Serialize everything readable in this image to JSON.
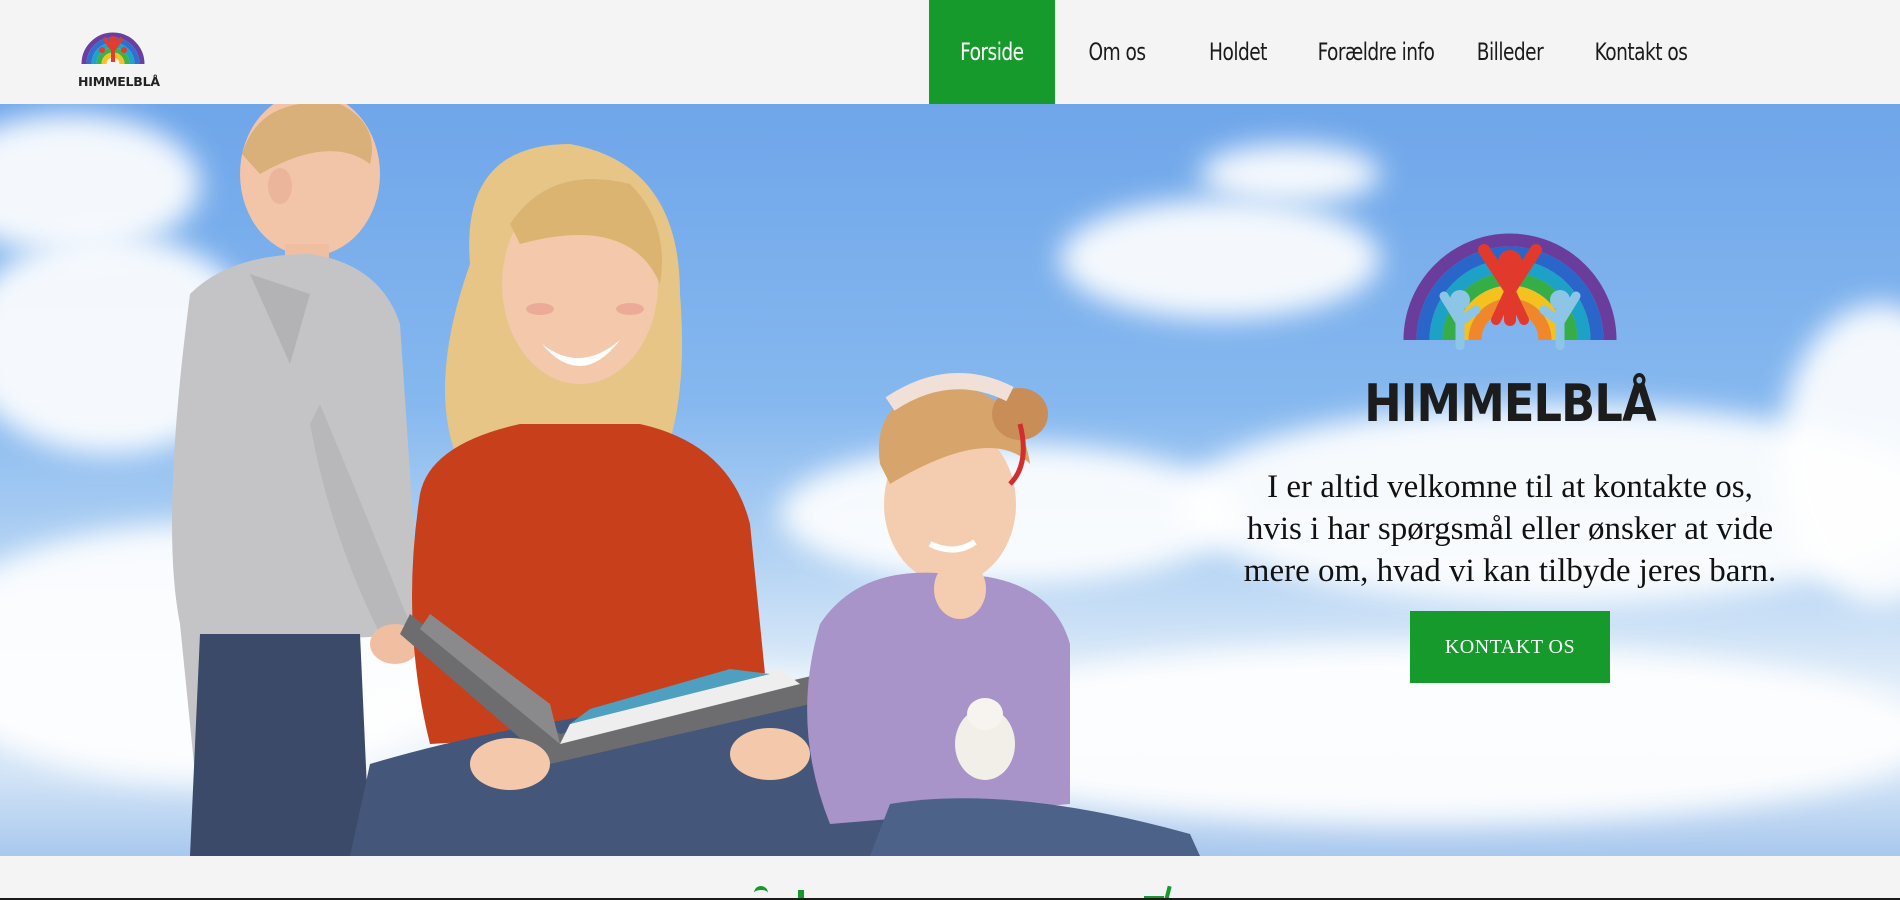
{
  "brand": {
    "name": "HIMMELBLÅ",
    "accent_color": "#169a2c",
    "logo_icon": "rainbow-family-logo"
  },
  "nav": {
    "items": [
      {
        "label": "Forside",
        "active": true
      },
      {
        "label": "Om os",
        "active": false
      },
      {
        "label": "Holdet",
        "active": false
      },
      {
        "label": "Forældre info",
        "active": false
      },
      {
        "label": "Billeder",
        "active": false
      },
      {
        "label": "Kontakt os",
        "active": false
      }
    ]
  },
  "hero": {
    "logo_text": "HIMMELBLÅ",
    "lines": [
      "I er altid velkomne til at kontakte os,",
      "hvis i har spørgsmål eller ønsker at vide",
      "mere om, hvad vi kan tilbyde jeres barn."
    ],
    "cta_label": "KONTAKT OS",
    "image_subject": "woman reading a book with a boy and a girl against a cloudy sky"
  }
}
